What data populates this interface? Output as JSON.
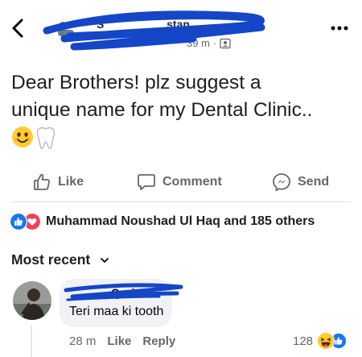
{
  "header": {
    "back_icon": "chevron-left-icon",
    "group_icon": "group-members-icon",
    "author_name": "S",
    "author_name_suffix": "stan",
    "time": "39 m",
    "separator": "·",
    "audience_icon": "members-only-icon",
    "more_icon": "more-horizontal-icon"
  },
  "post": {
    "line1": "Dear Brothers! plz suggest a",
    "line2": "unique name for my Dental Clinic..",
    "emojis": [
      "smiling-face-emoji",
      "tooth-emoji"
    ]
  },
  "actions": {
    "like": "Like",
    "comment": "Comment",
    "send": "Send"
  },
  "reactions": {
    "text": "Muhammad Noushad Ul Haq and 185 others",
    "icons": [
      "like-reaction-icon",
      "love-reaction-icon"
    ]
  },
  "sort": {
    "label": "Most recent"
  },
  "comment": {
    "author": "Qazi",
    "text": "Teri maa ki tooth",
    "time": "28 m",
    "like": "Like",
    "reply": "Reply",
    "reaction_count": "128",
    "reaction_icons": [
      "haha-reaction-icon",
      "like-reaction-icon"
    ]
  },
  "colors": {
    "accent_blue": "#1877f2",
    "love_red": "#f33e58",
    "scribble_blue": "#1546c8",
    "muted_text": "#65676b"
  }
}
